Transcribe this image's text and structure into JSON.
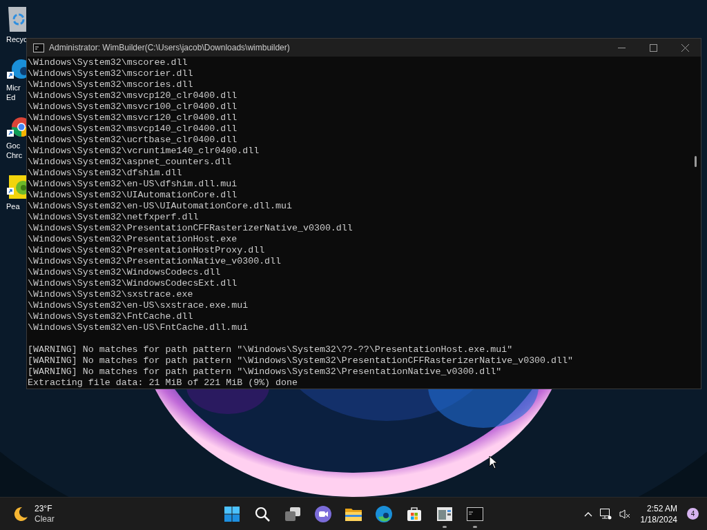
{
  "desktop_icons": [
    {
      "kind": "recycle",
      "label": [
        "Recyc"
      ]
    },
    {
      "kind": "edge",
      "label": [
        "Micr",
        "Ed"
      ]
    },
    {
      "kind": "chrome",
      "label": [
        "Goc",
        "Chrc"
      ]
    },
    {
      "kind": "pea",
      "label": [
        "Pea"
      ]
    }
  ],
  "window": {
    "title": "Administrator:  WimBuilder(C:\\Users\\jacob\\Downloads\\wimbuilder)"
  },
  "console": {
    "file_lines": [
      "\\Windows\\System32\\mscoree.dll",
      "\\Windows\\System32\\mscorier.dll",
      "\\Windows\\System32\\mscories.dll",
      "\\Windows\\System32\\msvcp120_clr0400.dll",
      "\\Windows\\System32\\msvcr100_clr0400.dll",
      "\\Windows\\System32\\msvcr120_clr0400.dll",
      "\\Windows\\System32\\msvcp140_clr0400.dll",
      "\\Windows\\System32\\ucrtbase_clr0400.dll",
      "\\Windows\\System32\\vcruntime140_clr0400.dll",
      "\\Windows\\System32\\aspnet_counters.dll",
      "\\Windows\\System32\\dfshim.dll",
      "\\Windows\\System32\\en-US\\dfshim.dll.mui",
      "\\Windows\\System32\\UIAutomationCore.dll",
      "\\Windows\\System32\\en-US\\UIAutomationCore.dll.mui",
      "\\Windows\\System32\\netfxperf.dll",
      "\\Windows\\System32\\PresentationCFFRasterizerNative_v0300.dll",
      "\\Windows\\System32\\PresentationHost.exe",
      "\\Windows\\System32\\PresentationHostProxy.dll",
      "\\Windows\\System32\\PresentationNative_v0300.dll",
      "\\Windows\\System32\\WindowsCodecs.dll",
      "\\Windows\\System32\\WindowsCodecsExt.dll",
      "\\Windows\\System32\\sxstrace.exe",
      "\\Windows\\System32\\en-US\\sxstrace.exe.mui",
      "\\Windows\\System32\\FntCache.dll",
      "\\Windows\\System32\\en-US\\FntCache.dll.mui"
    ],
    "message_lines": [
      "[WARNING] No matches for path pattern \"\\Windows\\System32\\??-??\\PresentationHost.exe.mui\"",
      "[WARNING] No matches for path pattern \"\\Windows\\System32\\PresentationCFFRasterizerNative_v0300.dll\"",
      "[WARNING] No matches for path pattern \"\\Windows\\System32\\PresentationNative_v0300.dll\"",
      "Extracting file data: 21 MiB of 221 MiB (9%) done"
    ]
  },
  "taskbar": {
    "weather": {
      "temperature": "23°F",
      "condition": "Clear"
    },
    "apps": [
      {
        "kind": "start",
        "running": false
      },
      {
        "kind": "search",
        "running": false
      },
      {
        "kind": "taskview",
        "running": false
      },
      {
        "kind": "chat",
        "running": false
      },
      {
        "kind": "explorer",
        "running": false
      },
      {
        "kind": "edge",
        "running": false
      },
      {
        "kind": "store",
        "running": false
      },
      {
        "kind": "wimbuilder",
        "running": true
      },
      {
        "kind": "terminal",
        "running": true
      }
    ],
    "time": "2:52 AM",
    "date": "1/18/2024",
    "notifications": "4"
  }
}
